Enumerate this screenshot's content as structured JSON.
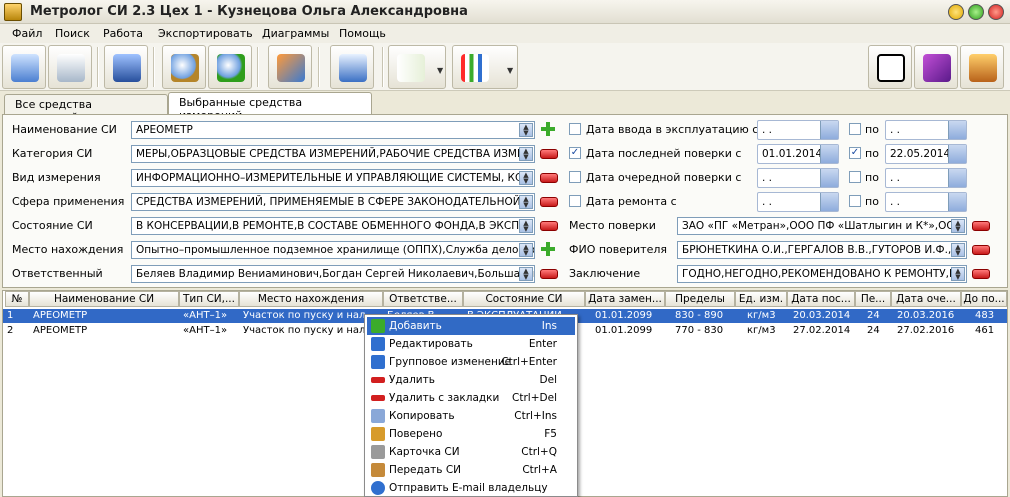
{
  "title": "Метролог СИ 2.3  Цех 1 - Кузнецова Ольга Александровна",
  "menu": [
    "Файл",
    "Поиск",
    "Работа",
    "Экспортировать",
    "Диаграммы",
    "Помощь"
  ],
  "tabs": [
    "Все средства измерений",
    "Выбранные средства измерений"
  ],
  "filters": {
    "name": {
      "label": "Наименование СИ",
      "value": "АРЕОМЕТР"
    },
    "category": {
      "label": "Категория СИ",
      "value": "МЕРЫ,ОБРАЗЦОВЫЕ СРЕДСТВА ИЗМЕРЕНИЙ,РАБОЧИЕ СРЕДСТВА ИЗМЕ"
    },
    "type": {
      "label": "Вид измерения",
      "value": "ИНФОРМАЦИОННО–ИЗМЕРИТЕЛЬНЫЕ И УПРАВЛЯЮЩИЕ СИСТЕМЫ, КС"
    },
    "scope": {
      "label": "Сфера применения",
      "value": "СРЕДСТВА ИЗМЕРЕНИЙ, ПРИМЕНЯЕМЫЕ В СФЕРЕ ЗАКОНОДАТЕЛЬНОЙ"
    },
    "state": {
      "label": "Состояние СИ",
      "value": "В КОНСЕРВАЦИИ,В РЕМОНТЕ,В СОСТАВЕ ОБМЕННОГО ФОНДА,В ЭКСПЛ:"
    },
    "location": {
      "label": "Место нахождения",
      "value": "Опытно–промышленное подземное хранилище (ОППХ),Служба делопрои"
    },
    "responsible": {
      "label": "Ответственный",
      "value": "Беляев Владимир Вениаминович,Богдан Сергей Николаевич,Большаков"
    }
  },
  "dates": {
    "commission": {
      "label": "Дата ввода в эксплуатацию с",
      "from": ". .",
      "to_label": "по",
      "to": ". ."
    },
    "last_check": {
      "label": "Дата последней поверки с",
      "from": "01.01.2014",
      "to_label": "по",
      "to": "22.05.2014"
    },
    "next_check": {
      "label": "Дата очередной поверки с",
      "from": ". .",
      "to_label": "по",
      "to": ". ."
    },
    "repair": {
      "label": "Дата ремонта с",
      "from": ". .",
      "to_label": "по",
      "to": ". ."
    }
  },
  "right_filters": {
    "check_place": {
      "label": "Место поверки",
      "value": "ЗАО «ПГ «Метран»,ООО ПФ «Шатлыгин и К*»,ООО"
    },
    "checker": {
      "label": "ФИО поверителя",
      "value": "БРЮНЕТКИНА О.И.,ГЕРГАЛОВ В.В.,ГУТОРОВ И.Ф.,З"
    },
    "conclusion": {
      "label": "Заключение",
      "value": "ГОДНО,НЕГОДНО,РЕКОМЕНДОВАНО К РЕМОНТУ,РЕ"
    }
  },
  "columns": [
    "№",
    "Наименование СИ",
    "Тип СИ,...",
    "Место нахождения",
    "Ответстве...",
    "Состояние СИ",
    "Дата замен...",
    "Пределы",
    "Ед. изм.",
    "Дата пос...",
    "Пе...",
    "Дата оче...",
    "До по..."
  ],
  "rows": [
    [
      "1",
      "АРЕОМЕТР",
      "«АНТ–1»",
      "Участок по пуску и нал...",
      "Беляев В...",
      "В ЭКСПЛУАТАЦИИ",
      "01.01.2099",
      "830 - 890",
      "кг/м3",
      "20.03.2014",
      "24",
      "20.03.2016",
      "483"
    ],
    [
      "2",
      "АРЕОМЕТР",
      "«АНТ–1»",
      "Участок по пуску и нал...",
      "",
      "",
      "01.01.2099",
      "770 - 830",
      "кг/м3",
      "27.02.2014",
      "24",
      "27.02.2016",
      "461"
    ]
  ],
  "context_menu": [
    {
      "label": "Добавить",
      "shortcut": "Ins",
      "icon": "add-icon",
      "color": "#3bab2b"
    },
    {
      "label": "Редактировать",
      "shortcut": "Enter",
      "icon": "edit-icon",
      "color": "#2f6fcf"
    },
    {
      "label": "Групповое изменение",
      "shortcut": "Ctrl+Enter",
      "icon": "group-edit-icon",
      "color": "#2f6fcf"
    },
    {
      "label": "Удалить",
      "shortcut": "Del",
      "icon": "delete-icon",
      "color": "#d21f1f"
    },
    {
      "label": "Удалить с закладки",
      "shortcut": "Ctrl+Del",
      "icon": "delete-tab-icon",
      "color": "#d21f1f"
    },
    {
      "label": "Копировать",
      "shortcut": "Ctrl+Ins",
      "icon": "copy-icon",
      "color": "#8aa8d8"
    },
    {
      "label": "Поверено",
      "shortcut": "F5",
      "icon": "verified-icon",
      "color": "#d79b2b"
    },
    {
      "label": "Карточка СИ",
      "shortcut": "Ctrl+Q",
      "icon": "card-icon",
      "color": "#9a9a9a"
    },
    {
      "label": "Передать СИ",
      "shortcut": "Ctrl+A",
      "icon": "transfer-icon",
      "color": "#c58a3a"
    },
    {
      "label": "Отправить E-mail владельцу",
      "shortcut": "",
      "icon": "email-icon",
      "color": "#2f6fcf"
    }
  ]
}
